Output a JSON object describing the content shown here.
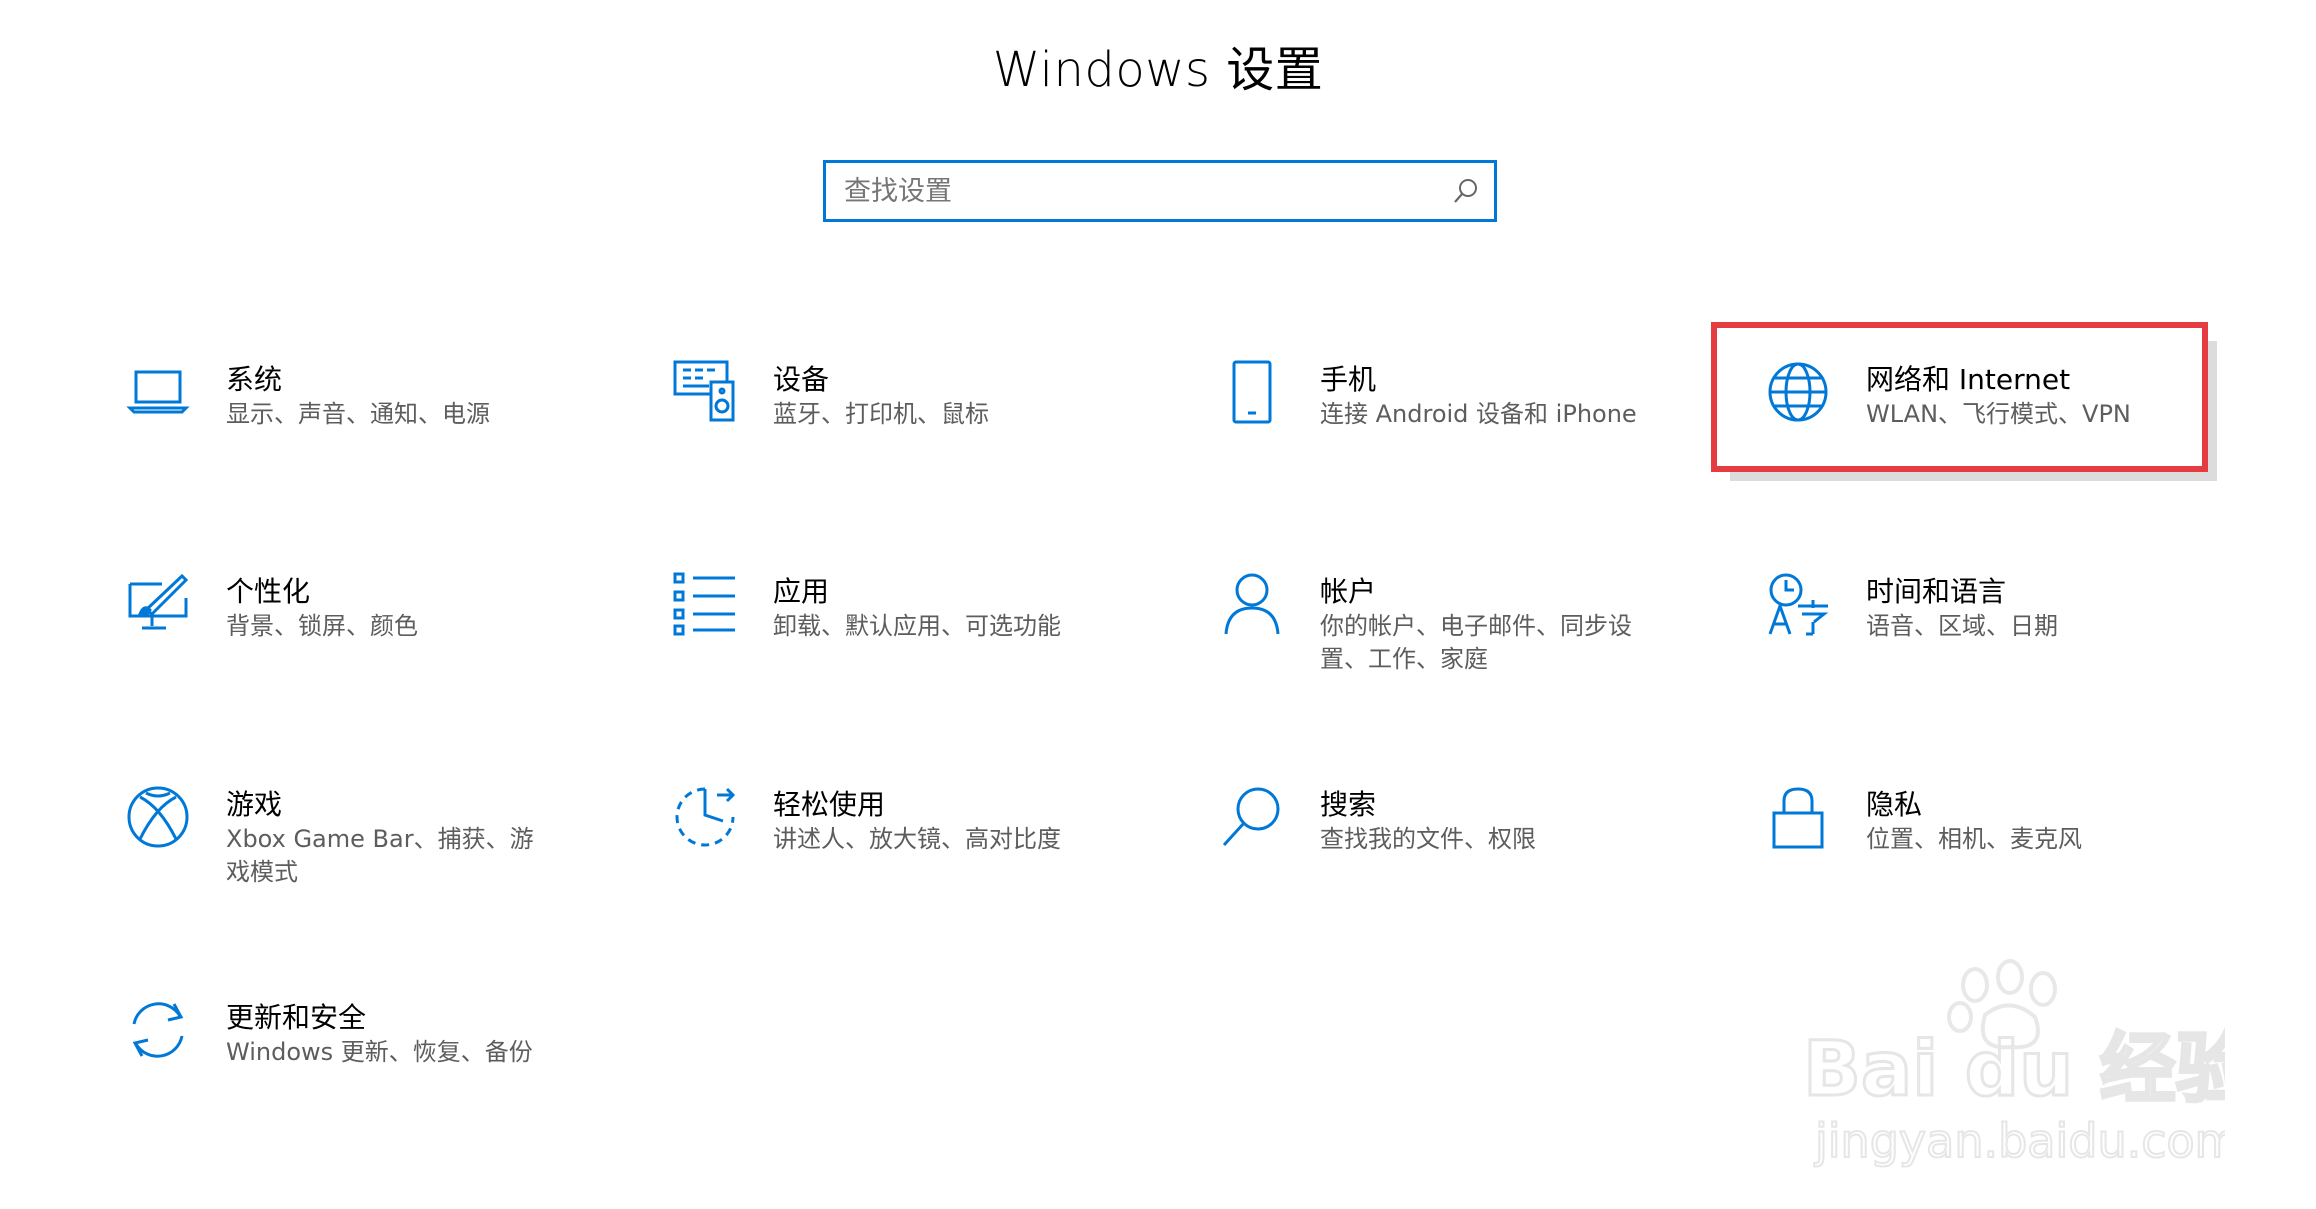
{
  "window": {
    "title": "Windows 设置"
  },
  "search": {
    "placeholder": "查找设置",
    "value": ""
  },
  "tiles": [
    {
      "title": "系统",
      "desc": "显示、声音、通知、电源",
      "icon": "laptop-icon"
    },
    {
      "title": "设备",
      "desc": "蓝牙、打印机、鼠标",
      "icon": "devices-icon"
    },
    {
      "title": "手机",
      "desc": "连接 Android 设备和 iPhone",
      "icon": "phone-icon"
    },
    {
      "title": "网络和 Internet",
      "desc": "WLAN、飞行模式、VPN",
      "icon": "globe-icon"
    },
    {
      "title": "个性化",
      "desc": "背景、锁屏、颜色",
      "icon": "personalization-icon"
    },
    {
      "title": "应用",
      "desc": "卸载、默认应用、可选功能",
      "icon": "apps-list-icon"
    },
    {
      "title": "帐户",
      "desc": "你的帐户、电子邮件、同步设置、工作、家庭",
      "icon": "person-icon"
    },
    {
      "title": "时间和语言",
      "desc": "语音、区域、日期",
      "icon": "time-language-icon"
    },
    {
      "title": "游戏",
      "desc": "Xbox Game Bar、捕获、游戏模式",
      "icon": "xbox-icon"
    },
    {
      "title": "轻松使用",
      "desc": "讲述人、放大镜、高对比度",
      "icon": "ease-of-access-icon"
    },
    {
      "title": "搜索",
      "desc": "查找我的文件、权限",
      "icon": "search-magnifier-icon"
    },
    {
      "title": "隐私",
      "desc": "位置、相机、麦克风",
      "icon": "lock-icon"
    },
    {
      "title": "更新和安全",
      "desc": "Windows 更新、恢复、备份",
      "icon": "sync-icon"
    }
  ],
  "watermark": {
    "brand": "Bai du 经验",
    "url": "jingyan.baidu.com"
  },
  "colors": {
    "accent": "#0078d7",
    "highlight": "#e53c42",
    "description_text": "#5d5d5d"
  }
}
